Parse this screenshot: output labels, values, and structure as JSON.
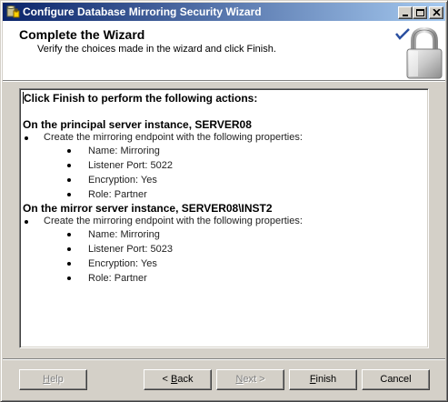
{
  "window": {
    "title": "Configure Database Mirroring Security Wizard",
    "icons": {
      "app": "database-wizard-icon",
      "minimize": "minimize-icon",
      "maximize": "maximize-icon",
      "close": "close-icon"
    }
  },
  "header": {
    "title": "Complete the Wizard",
    "subtitle": "Verify the choices made in the wizard and click Finish.",
    "graphic": "padlock-checkmark-icon"
  },
  "report": {
    "intro": "Click Finish to perform the following actions:",
    "sections": [
      {
        "heading": "On the principal server instance, SERVER08",
        "action": "Create the mirroring endpoint with the following properties:",
        "properties": [
          "Name: Mirroring",
          "Listener Port: 5022",
          "Encryption: Yes",
          "Role: Partner"
        ]
      },
      {
        "heading": "On the mirror server instance, SERVER08\\INST2",
        "action": "Create the mirroring endpoint with the following properties:",
        "properties": [
          "Name: Mirroring",
          "Listener Port: 5023",
          "Encryption: Yes",
          "Role: Partner"
        ]
      }
    ]
  },
  "buttons": {
    "help": {
      "pre": "",
      "key": "H",
      "post": "elp",
      "enabled": false
    },
    "back": {
      "pre": "< ",
      "key": "B",
      "post": "ack",
      "enabled": true
    },
    "next": {
      "pre": "",
      "key": "N",
      "post": "ext >",
      "enabled": false
    },
    "finish": {
      "pre": "",
      "key": "F",
      "post": "inish",
      "enabled": true
    },
    "cancel": {
      "pre": "",
      "key": "",
      "post": "Cancel",
      "enabled": true
    }
  },
  "colors": {
    "titlebar_start": "#0a246a",
    "titlebar_end": "#a6caf0",
    "face": "#d4d0c8"
  }
}
